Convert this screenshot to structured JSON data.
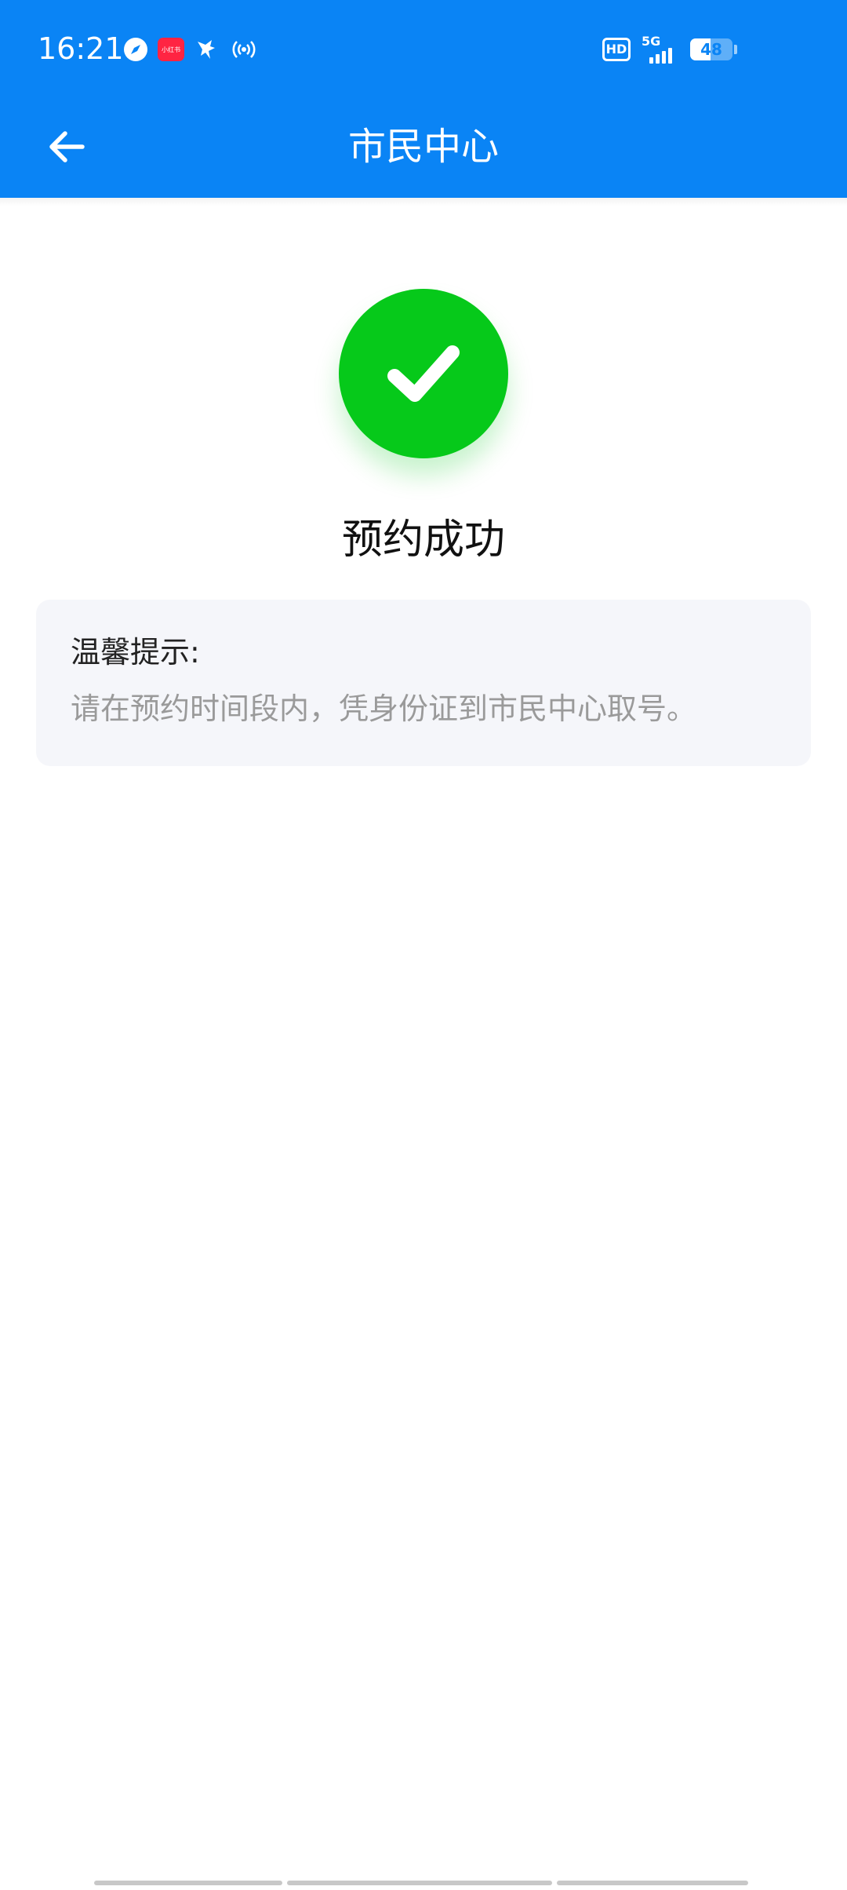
{
  "status_bar": {
    "time": "16:21",
    "app_badge": "小红书",
    "hd_label": "HD",
    "network_type": "5G",
    "battery_level": "48",
    "battery_fraction": 0.48
  },
  "app_bar": {
    "title": "市民中心",
    "back_icon": "arrow-left-icon"
  },
  "result": {
    "icon": "check-circle-icon",
    "status": "预约成功",
    "accent_color": "#06c91a"
  },
  "tip": {
    "title": "温馨提示:",
    "body": "请在预约时间段内，凭身份证到市民中心取号。"
  },
  "colors": {
    "header": "#0a84f5",
    "tip_background": "#f5f6fa",
    "tip_body_text": "#9a9a9a"
  }
}
